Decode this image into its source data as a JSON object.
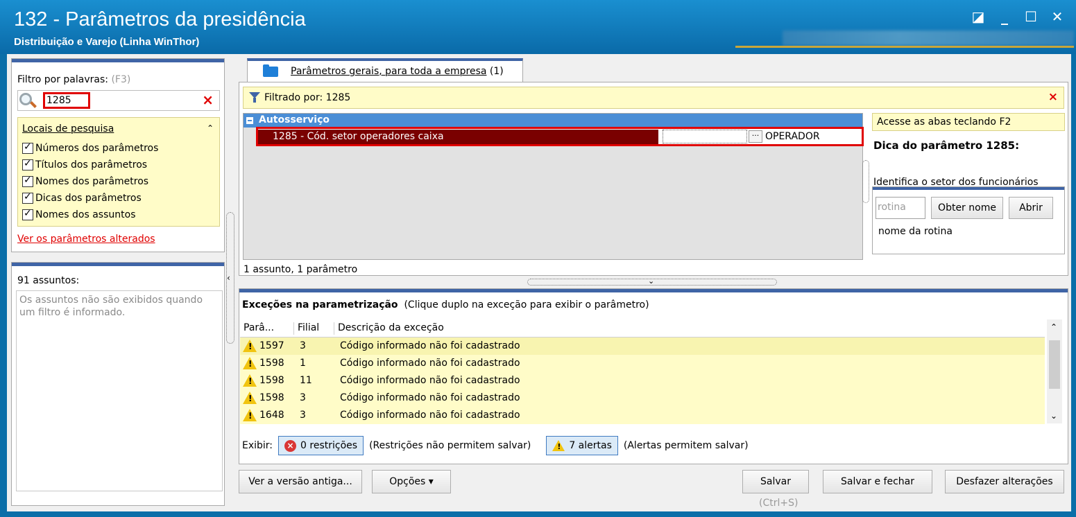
{
  "window": {
    "title": "132 - Parâmetros da presidência",
    "subtitle": "Distribuição e Varejo (Linha WinThor)",
    "controls": {
      "restore": "◪",
      "minimize": "_",
      "maximize": "☐",
      "close": "✕"
    }
  },
  "filter": {
    "label": "Filtro por palavras:",
    "shortcut": "(F3)",
    "value": "1285",
    "clear": "×",
    "locais_title": "Locais de pesquisa",
    "collapse": "⌃",
    "options": [
      "Números dos parâmetros",
      "Títulos dos parâmetros",
      "Nomes dos parâmetros",
      "Dicas dos parâmetros",
      "Nomes dos assuntos"
    ],
    "changed_link": "Ver os parâmetros alterados"
  },
  "assuntos": {
    "count_label": "91 assuntos:",
    "message": "Os assuntos não são exibidos quando um filtro é informado."
  },
  "tab": {
    "label": "Parâmetros gerais, para toda a empresa",
    "count": "(1)"
  },
  "filtered": {
    "label": "Filtrado por: 1285",
    "clear": "×"
  },
  "grid": {
    "group": "Autosserviço",
    "param_label": "1285 - Cód. setor operadores caixa",
    "param_ellipsis": "···",
    "param_value": "OPERADOR",
    "footer": "1 assunto, 1 parâmetro"
  },
  "tip": {
    "hint": "Acesse as abas teclando F2",
    "title": "Dica do parâmetro 1285:",
    "desc": "Identifica o setor dos funcionários",
    "rotina_placeholder": "rotina",
    "obter_button": "Obter nome",
    "abrir_button": "Abrir",
    "rotina_label": "nome da rotina"
  },
  "exceptions": {
    "title": "Exceções na parametrização",
    "subtitle": "(Clique duplo na exceção para exibir o parâmetro)",
    "columns": [
      "Parâ...",
      "Filial",
      "Descrição da exceção"
    ],
    "rows": [
      {
        "param": "1597",
        "filial": "3",
        "desc": "Código informado não foi cadastrado"
      },
      {
        "param": "1598",
        "filial": "1",
        "desc": "Código informado não foi cadastrado"
      },
      {
        "param": "1598",
        "filial": "11",
        "desc": "Código informado não foi cadastrado"
      },
      {
        "param": "1598",
        "filial": "3",
        "desc": "Código informado não foi cadastrado"
      },
      {
        "param": "1648",
        "filial": "3",
        "desc": "Código informado não foi cadastrado"
      }
    ],
    "exibir_label": "Exibir:",
    "restricoes": "0 restrições",
    "restricoes_note": "(Restrições não permitem salvar)",
    "alertas": "7 alertas",
    "alertas_note": "(Alertas permitem salvar)"
  },
  "buttons": {
    "old_version": "Ver a versão antiga...",
    "options": "Opções ▾",
    "save": "Salvar",
    "save_shortcut": "(Ctrl+S)",
    "save_close": "Salvar e fechar",
    "undo": "Desfazer alterações"
  }
}
